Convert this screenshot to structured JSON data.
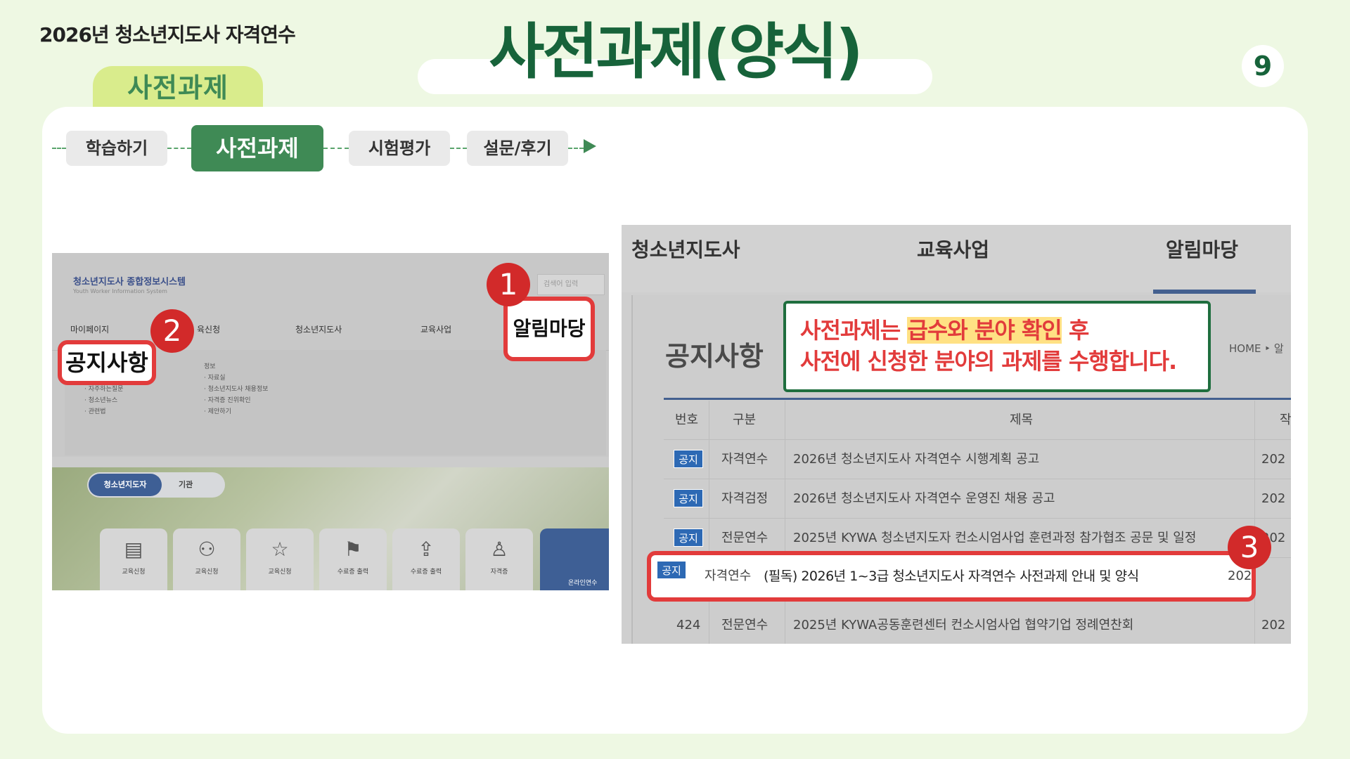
{
  "header": {
    "course_title": "2026년 청소년지도사 자격연수",
    "section_label": "사전과제",
    "main_title": "사전과제(양식)",
    "page_number": "9"
  },
  "steps": [
    {
      "label": "학습하기",
      "active": false
    },
    {
      "label": "사전과제",
      "active": true
    },
    {
      "label": "시험평가",
      "active": false
    },
    {
      "label": "설문/후기",
      "active": false
    }
  ],
  "left_screenshot": {
    "brand": "청소년지도사 종합정보시스템",
    "brand_sub": "Youth Worker Information System",
    "search_placeholder": "검색어 입력",
    "menu": [
      "마이페이지",
      "육신청",
      "청소년지도사",
      "교육사업",
      "알림마당"
    ],
    "submenu_col1": [
      "자주하는질문",
      "청소년뉴스",
      "관련법"
    ],
    "submenu_col2": [
      "정보",
      "자료실",
      "청소년지도사 채용정보",
      "자격증 진위확인",
      "제안하기"
    ],
    "toggle": [
      "청소년지도자",
      "기관"
    ],
    "tiles": [
      "교육신청",
      "교육신청",
      "교육신청",
      "수료증 출력",
      "수료증 출력",
      "자격증"
    ],
    "blue_tile": "온라인연수",
    "highlight_1": "알림마당",
    "highlight_2": "공지사항",
    "badge_1": "1",
    "badge_2": "2"
  },
  "right_screenshot": {
    "nav": [
      "청소년지도사",
      "교육사업",
      "알림마당"
    ],
    "heading": "공지사항",
    "breadcrumb": "HOME ‣ 알",
    "callout": {
      "line1_pre": "사전과제는 ",
      "line1_mark": "급수와 분야 확인",
      "line1_post": " 후",
      "line2": "사전에 신청한 분야의 과제를 수행합니다."
    },
    "table": {
      "headers": [
        "번호",
        "구분",
        "제목",
        "작"
      ],
      "rows": [
        {
          "num": "공지",
          "category": "자격연수",
          "title": "2026년 청소년지도사 자격연수 시행계획 공고",
          "date": "202"
        },
        {
          "num": "공지",
          "category": "자격검정",
          "title": "2026년 청소년지도사 자격연수 운영진 채용 공고",
          "date": "202"
        },
        {
          "num": "공지",
          "category": "전문연수",
          "title": "2025년 KYWA 청소년지도자 컨소시엄사업 훈련과정 참가협조 공문 및 일정",
          "date": "202"
        },
        {
          "num": "공지",
          "category": "자격연수",
          "title": "(필독) 2026년 1~3급 청소년지도사 자격연수 사전과제 안내 및 양식",
          "date": "202"
        },
        {
          "num": "424",
          "category": "전문연수",
          "title": "2025년 KYWA공동훈련센터 컨소시엄사업 협약기업 정례연찬회",
          "date": "202"
        }
      ]
    },
    "badge_3": "3"
  },
  "colors": {
    "brand_green": "#17633a",
    "step_green": "#3f8a55",
    "highlight_red": "#e23b3b",
    "notice_blue": "#2d69b4"
  }
}
